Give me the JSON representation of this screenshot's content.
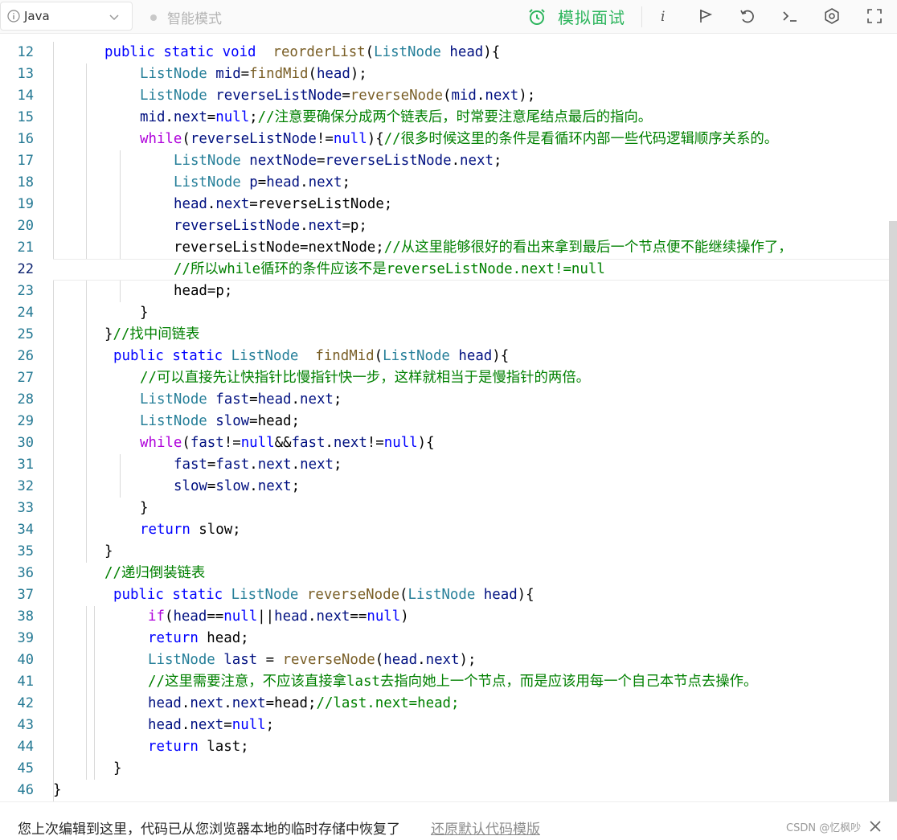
{
  "toolbar": {
    "language": "Java",
    "smart_mode": "智能模式",
    "mock_interview": "模拟面试"
  },
  "colors": {
    "accent_green": "#2db55d",
    "line_number": "#237893",
    "keyword": "#0000ff",
    "type": "#267f99",
    "function": "#795e26",
    "comment": "#008000",
    "control": "#af00db"
  },
  "editor": {
    "current_line": "22",
    "lines": [
      {
        "n": "12",
        "indent": 64,
        "tokens": [
          [
            "kw",
            "public"
          ],
          [
            "",
            " "
          ],
          [
            "kw",
            "static"
          ],
          [
            "",
            " "
          ],
          [
            "kw",
            "void"
          ],
          [
            "",
            "  "
          ],
          [
            "fn",
            "reorderList"
          ],
          [
            "",
            "("
          ],
          [
            "ty",
            "ListNode"
          ],
          [
            "",
            " "
          ],
          [
            "id",
            "head"
          ],
          [
            "",
            "){"
          ]
        ]
      },
      {
        "n": "13",
        "indent": 108,
        "tokens": [
          [
            "ty",
            "ListNode"
          ],
          [
            "",
            " "
          ],
          [
            "id",
            "mid"
          ],
          [
            "",
            "="
          ],
          [
            "fn",
            "findMid"
          ],
          [
            "",
            "("
          ],
          [
            "id",
            "head"
          ],
          [
            "",
            ");"
          ]
        ]
      },
      {
        "n": "14",
        "indent": 108,
        "tokens": [
          [
            "ty",
            "ListNode"
          ],
          [
            "",
            " "
          ],
          [
            "id",
            "reverseListNode"
          ],
          [
            "",
            "="
          ],
          [
            "fn",
            "reverseNode"
          ],
          [
            "",
            "("
          ],
          [
            "id",
            "mid"
          ],
          [
            "",
            "."
          ],
          [
            "id",
            "next"
          ],
          [
            "",
            ");"
          ]
        ]
      },
      {
        "n": "15",
        "indent": 108,
        "tokens": [
          [
            "id",
            "mid"
          ],
          [
            "",
            "."
          ],
          [
            "id",
            "next"
          ],
          [
            "",
            "="
          ],
          [
            "kw",
            "null"
          ],
          [
            "",
            ";"
          ],
          [
            "cm",
            "//注意要确保分成两个链表后，时常要注意尾结点最后的指向。"
          ]
        ]
      },
      {
        "n": "16",
        "indent": 108,
        "tokens": [
          [
            "ctl",
            "while"
          ],
          [
            "",
            "("
          ],
          [
            "id",
            "reverseListNode"
          ],
          [
            "",
            "!="
          ],
          [
            "kw",
            "null"
          ],
          [
            "",
            "){"
          ],
          [
            "cm",
            "//很多时候这里的条件是看循环内部一些代码逻辑顺序关系的。"
          ]
        ]
      },
      {
        "n": "17",
        "indent": 150,
        "tokens": [
          [
            "ty",
            "ListNode"
          ],
          [
            "",
            " "
          ],
          [
            "id",
            "nextNode"
          ],
          [
            "",
            "="
          ],
          [
            "id",
            "reverseListNode"
          ],
          [
            "",
            "."
          ],
          [
            "id",
            "next"
          ],
          [
            "",
            ";"
          ]
        ]
      },
      {
        "n": "18",
        "indent": 150,
        "tokens": [
          [
            "ty",
            "ListNode"
          ],
          [
            "",
            " "
          ],
          [
            "id",
            "p"
          ],
          [
            "",
            "="
          ],
          [
            "id",
            "head"
          ],
          [
            "",
            "."
          ],
          [
            "id",
            "next"
          ],
          [
            "",
            ";"
          ]
        ]
      },
      {
        "n": "19",
        "indent": 150,
        "tokens": [
          [
            "id",
            "head"
          ],
          [
            "",
            "."
          ],
          [
            "id",
            "next"
          ],
          [
            "",
            "="
          ],
          [
            "",
            "reverseListNode;"
          ]
        ]
      },
      {
        "n": "20",
        "indent": 150,
        "tokens": [
          [
            "id",
            "reverseListNode"
          ],
          [
            "",
            "."
          ],
          [
            "id",
            "next"
          ],
          [
            "",
            "="
          ],
          [
            "",
            "p;"
          ]
        ]
      },
      {
        "n": "21",
        "indent": 150,
        "tokens": [
          [
            "",
            "reverseListNode=nextNode;"
          ],
          [
            "cm",
            "//从这里能够很好的看出来拿到最后一个节点便不能继续操作了，"
          ]
        ]
      },
      {
        "n": "22",
        "indent": 150,
        "tokens": [
          [
            "cm",
            "//所以while循环的条件应该不是reverseListNode.next!=null"
          ]
        ]
      },
      {
        "n": "23",
        "indent": 150,
        "tokens": [
          [
            "",
            "head=p;"
          ]
        ]
      },
      {
        "n": "24",
        "indent": 108,
        "tokens": [
          [
            "",
            "}"
          ]
        ]
      },
      {
        "n": "25",
        "indent": 64,
        "tokens": [
          [
            "",
            "}"
          ],
          [
            "cm",
            "//找中间链表"
          ]
        ]
      },
      {
        "n": "26",
        "indent": 75,
        "tokens": [
          [
            "kw",
            "public"
          ],
          [
            "",
            " "
          ],
          [
            "kw",
            "static"
          ],
          [
            "",
            " "
          ],
          [
            "ty",
            "ListNode"
          ],
          [
            "",
            "  "
          ],
          [
            "fn",
            "findMid"
          ],
          [
            "",
            "("
          ],
          [
            "ty",
            "ListNode"
          ],
          [
            "",
            " "
          ],
          [
            "id",
            "head"
          ],
          [
            "",
            "){"
          ]
        ]
      },
      {
        "n": "27",
        "indent": 108,
        "tokens": [
          [
            "cm",
            "//可以直接先让快指针比慢指针快一步，这样就相当于是慢指针的两倍。"
          ]
        ]
      },
      {
        "n": "28",
        "indent": 108,
        "tokens": [
          [
            "ty",
            "ListNode"
          ],
          [
            "",
            " "
          ],
          [
            "id",
            "fast"
          ],
          [
            "",
            "="
          ],
          [
            "id",
            "head"
          ],
          [
            "",
            "."
          ],
          [
            "id",
            "next"
          ],
          [
            "",
            ";"
          ]
        ]
      },
      {
        "n": "29",
        "indent": 108,
        "tokens": [
          [
            "ty",
            "ListNode"
          ],
          [
            "",
            " "
          ],
          [
            "id",
            "slow"
          ],
          [
            "",
            "="
          ],
          [
            "",
            "head;"
          ]
        ]
      },
      {
        "n": "30",
        "indent": 108,
        "tokens": [
          [
            "ctl",
            "while"
          ],
          [
            "",
            "("
          ],
          [
            "id",
            "fast"
          ],
          [
            "",
            "!="
          ],
          [
            "kw",
            "null"
          ],
          [
            "",
            "&&"
          ],
          [
            "id",
            "fast"
          ],
          [
            "",
            "."
          ],
          [
            "id",
            "next"
          ],
          [
            "",
            "!="
          ],
          [
            "kw",
            "null"
          ],
          [
            "",
            "){"
          ]
        ]
      },
      {
        "n": "31",
        "indent": 150,
        "tokens": [
          [
            "id",
            "fast"
          ],
          [
            "",
            "="
          ],
          [
            "id",
            "fast"
          ],
          [
            "",
            "."
          ],
          [
            "id",
            "next"
          ],
          [
            "",
            "."
          ],
          [
            "id",
            "next"
          ],
          [
            "",
            ";"
          ]
        ]
      },
      {
        "n": "32",
        "indent": 150,
        "tokens": [
          [
            "id",
            "slow"
          ],
          [
            "",
            "="
          ],
          [
            "id",
            "slow"
          ],
          [
            "",
            "."
          ],
          [
            "id",
            "next"
          ],
          [
            "",
            ";"
          ]
        ]
      },
      {
        "n": "33",
        "indent": 108,
        "tokens": [
          [
            "",
            "}"
          ]
        ]
      },
      {
        "n": "34",
        "indent": 108,
        "tokens": [
          [
            "kw",
            "return"
          ],
          [
            "",
            " slow;"
          ]
        ]
      },
      {
        "n": "35",
        "indent": 64,
        "tokens": [
          [
            "",
            "}"
          ]
        ]
      },
      {
        "n": "36",
        "indent": 64,
        "tokens": [
          [
            "cm",
            "//递归倒装链表"
          ]
        ]
      },
      {
        "n": "37",
        "indent": 75,
        "tokens": [
          [
            "kw",
            "public"
          ],
          [
            "",
            " "
          ],
          [
            "kw",
            "static"
          ],
          [
            "",
            " "
          ],
          [
            "ty",
            "ListNode"
          ],
          [
            "",
            " "
          ],
          [
            "fn",
            "reverseNode"
          ],
          [
            "",
            "("
          ],
          [
            "ty",
            "ListNode"
          ],
          [
            "",
            " "
          ],
          [
            "id",
            "head"
          ],
          [
            "",
            "){"
          ]
        ]
      },
      {
        "n": "38",
        "indent": 118,
        "tokens": [
          [
            "ctl",
            "if"
          ],
          [
            "",
            "("
          ],
          [
            "id",
            "head"
          ],
          [
            "",
            "=="
          ],
          [
            "kw",
            "null"
          ],
          [
            "",
            "||"
          ],
          [
            "id",
            "head"
          ],
          [
            "",
            "."
          ],
          [
            "id",
            "next"
          ],
          [
            "",
            "=="
          ],
          [
            "kw",
            "null"
          ],
          [
            "",
            ")"
          ]
        ]
      },
      {
        "n": "39",
        "indent": 118,
        "tokens": [
          [
            "kw",
            "return"
          ],
          [
            "",
            " head;"
          ]
        ]
      },
      {
        "n": "40",
        "indent": 118,
        "tokens": [
          [
            "ty",
            "ListNode"
          ],
          [
            "",
            " "
          ],
          [
            "id",
            "last"
          ],
          [
            "",
            " = "
          ],
          [
            "fn",
            "reverseNode"
          ],
          [
            "",
            "("
          ],
          [
            "id",
            "head"
          ],
          [
            "",
            "."
          ],
          [
            "id",
            "next"
          ],
          [
            "",
            ");"
          ]
        ]
      },
      {
        "n": "41",
        "indent": 118,
        "tokens": [
          [
            "cm",
            "//这里需要注意，不应该直接拿last去指向她上一个节点，而是应该用每一个自己本节点去操作。"
          ]
        ]
      },
      {
        "n": "42",
        "indent": 118,
        "tokens": [
          [
            "id",
            "head"
          ],
          [
            "",
            "."
          ],
          [
            "id",
            "next"
          ],
          [
            "",
            "."
          ],
          [
            "id",
            "next"
          ],
          [
            "",
            "="
          ],
          [
            "",
            "head;"
          ],
          [
            "cm",
            "//last.next=head;"
          ]
        ]
      },
      {
        "n": "43",
        "indent": 118,
        "tokens": [
          [
            "id",
            "head"
          ],
          [
            "",
            "."
          ],
          [
            "id",
            "next"
          ],
          [
            "",
            "="
          ],
          [
            "kw",
            "null"
          ],
          [
            "",
            ";"
          ]
        ]
      },
      {
        "n": "44",
        "indent": 118,
        "tokens": [
          [
            "kw",
            "return"
          ],
          [
            "",
            " last;"
          ]
        ]
      },
      {
        "n": "45",
        "indent": 75,
        "tokens": [
          [
            "",
            "}"
          ]
        ]
      },
      {
        "n": "46",
        "indent": 0,
        "tokens": [
          [
            "",
            "}"
          ]
        ]
      }
    ]
  },
  "notice": {
    "message": "您上次编辑到这里，代码已从您浏览器本地的临时存储中恢复了",
    "restore_link": "还原默认代码模版",
    "watermark": "CSDN @忆枫吵"
  }
}
